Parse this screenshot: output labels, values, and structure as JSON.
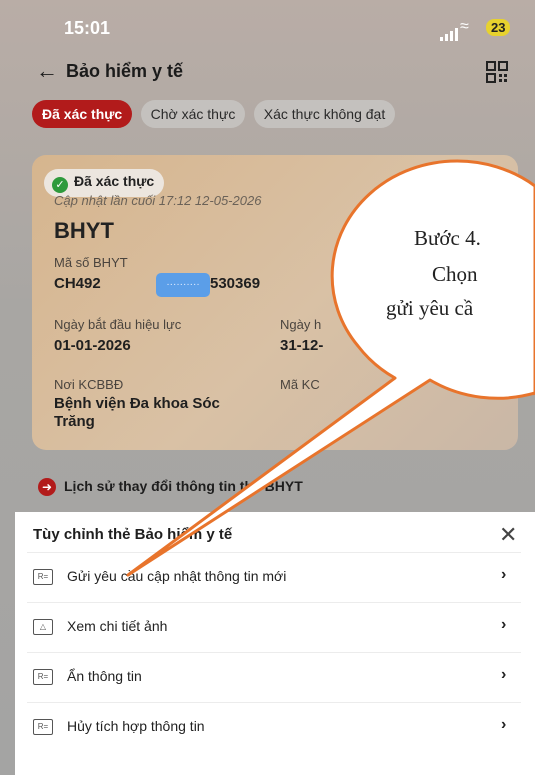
{
  "status_bar": {
    "time": "15:01",
    "battery": "23"
  },
  "header": {
    "title": "Bảo hiểm y tế",
    "back_icon": "arrow-left-icon",
    "qr_icon": "qr-code-icon"
  },
  "tabs": [
    {
      "label": "Đã xác thực",
      "active": true
    },
    {
      "label": "Chờ xác thực",
      "active": false
    },
    {
      "label": "Xác thực không đạt",
      "active": false
    }
  ],
  "card": {
    "status_badge": "Đã xác thực",
    "updated": "Cập nhật lần cuối 17:12 12-05-2026",
    "title": "BHYT",
    "code_label": "Mã số BHYT",
    "code_prefix": "CH492",
    "code_suffix": "530369",
    "start_label": "Ngày bắt đầu hiệu lực",
    "start_value": "01-01-2026",
    "end_label": "Ngày h",
    "end_value": "31-12-",
    "place_label": "Nơi KCBBĐ",
    "place_value": "Bệnh viện Đa khoa Sóc Trăng",
    "maker_label": "Mã KC",
    "more_icon": "kebab-menu-icon"
  },
  "history_link": "Lịch sử thay đổi thông tin thẻ BHYT",
  "sheet": {
    "title": "Tùy chỉnh thẻ Bảo hiểm y tế",
    "items": [
      {
        "label": "Gửi yêu cầu cập nhật thông tin mới",
        "icon": "id-card-icon"
      },
      {
        "label": "Xem chi tiết ảnh",
        "icon": "image-icon"
      },
      {
        "label": "Ẩn thông tin",
        "icon": "id-card-icon"
      },
      {
        "label": "Hủy tích hợp thông tin",
        "icon": "id-card-icon"
      }
    ]
  },
  "callout": {
    "line1": "Bước 4.",
    "line2": "Chọn",
    "line3": "gửi yêu cầ"
  },
  "colors": {
    "accent": "#b21b1b",
    "callout_border": "#e8742c",
    "success": "#2e9a3c"
  }
}
